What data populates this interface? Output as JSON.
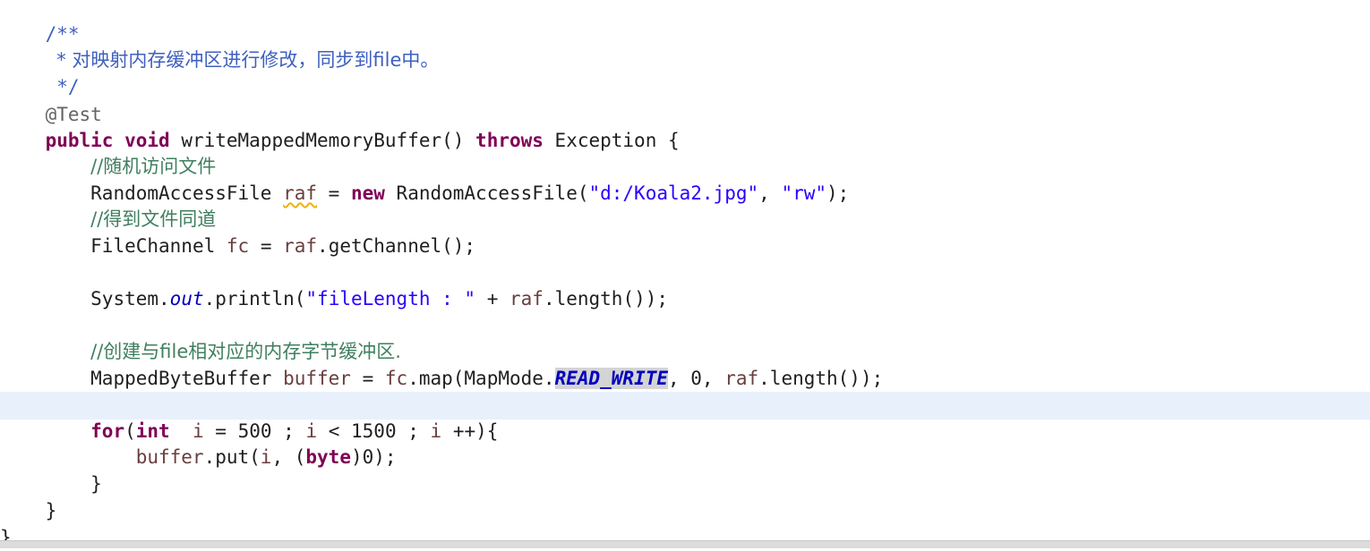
{
  "editor": {
    "lines": [
      {
        "indent": "    ",
        "tokens": [
          {
            "text": "/**",
            "kind": "javadoc"
          }
        ]
      },
      {
        "indent": "     ",
        "tokens": [
          {
            "text": "* 对映射内存缓冲区进行修改，同步到file中。",
            "kind": "javadoc"
          }
        ]
      },
      {
        "indent": "     ",
        "tokens": [
          {
            "text": "*/",
            "kind": "javadoc"
          }
        ]
      },
      {
        "indent": "    ",
        "tokens": [
          {
            "text": "@Test",
            "kind": "annotation"
          }
        ]
      },
      {
        "indent": "    ",
        "tokens": [
          {
            "text": "public",
            "kind": "keyword"
          },
          {
            "text": " "
          },
          {
            "text": "void",
            "kind": "keyword"
          },
          {
            "text": " writeMappedMemoryBuffer() "
          },
          {
            "text": "throws",
            "kind": "keyword"
          },
          {
            "text": " Exception {"
          }
        ]
      },
      {
        "indent": "        ",
        "tokens": [
          {
            "text": "//随机访问文件",
            "kind": "comment"
          }
        ]
      },
      {
        "indent": "        ",
        "tokens": [
          {
            "text": "RandomAccessFile "
          },
          {
            "text": "raf",
            "kind": "local-var warn"
          },
          {
            "text": " = "
          },
          {
            "text": "new",
            "kind": "keyword"
          },
          {
            "text": " RandomAccessFile("
          },
          {
            "text": "\"d:/Koala2.jpg\"",
            "kind": "string"
          },
          {
            "text": ", "
          },
          {
            "text": "\"rw\"",
            "kind": "string"
          },
          {
            "text": ");"
          }
        ]
      },
      {
        "indent": "        ",
        "tokens": [
          {
            "text": "//得到文件同道",
            "kind": "comment"
          }
        ]
      },
      {
        "indent": "        ",
        "tokens": [
          {
            "text": "FileChannel "
          },
          {
            "text": "fc",
            "kind": "local-var"
          },
          {
            "text": " = "
          },
          {
            "text": "raf",
            "kind": "local-var"
          },
          {
            "text": ".getChannel();"
          }
        ]
      },
      {
        "indent": "",
        "tokens": []
      },
      {
        "indent": "        ",
        "tokens": [
          {
            "text": "System."
          },
          {
            "text": "out",
            "kind": "static-field"
          },
          {
            "text": ".println("
          },
          {
            "text": "\"fileLength : \"",
            "kind": "string"
          },
          {
            "text": " + "
          },
          {
            "text": "raf",
            "kind": "local-var"
          },
          {
            "text": ".length());"
          }
        ]
      },
      {
        "indent": "",
        "tokens": []
      },
      {
        "indent": "        ",
        "tokens": [
          {
            "text": "//创建与file相对应的内存字节缓冲区.",
            "kind": "comment"
          }
        ]
      },
      {
        "indent": "        ",
        "tokens": [
          {
            "text": "MappedByteBuffer "
          },
          {
            "text": "buffer",
            "kind": "local-var"
          },
          {
            "text": " = "
          },
          {
            "text": "fc",
            "kind": "local-var"
          },
          {
            "text": ".map(MapMode."
          },
          {
            "text": "READ_WRITE",
            "kind": "const-field occurrence"
          },
          {
            "text": ", 0, "
          },
          {
            "text": "raf",
            "kind": "local-var"
          },
          {
            "text": ".length());"
          }
        ]
      },
      {
        "indent": "",
        "tokens": []
      },
      {
        "indent": "        ",
        "tokens": [
          {
            "text": "for",
            "kind": "keyword"
          },
          {
            "text": "("
          },
          {
            "text": "int",
            "kind": "keyword"
          },
          {
            "text": "  "
          },
          {
            "text": "i",
            "kind": "local-var"
          },
          {
            "text": " = 500 ; "
          },
          {
            "text": "i",
            "kind": "local-var"
          },
          {
            "text": " < 1500 ; "
          },
          {
            "text": "i",
            "kind": "local-var"
          },
          {
            "text": " ++){"
          }
        ]
      },
      {
        "indent": "            ",
        "tokens": [
          {
            "text": "buffer",
            "kind": "local-var"
          },
          {
            "text": ".put("
          },
          {
            "text": "i",
            "kind": "local-var"
          },
          {
            "text": ", ("
          },
          {
            "text": "byte",
            "kind": "keyword"
          },
          {
            "text": ")0);"
          }
        ]
      },
      {
        "indent": "        ",
        "tokens": [
          {
            "text": "}"
          }
        ]
      },
      {
        "indent": "    ",
        "tokens": [
          {
            "text": "}"
          }
        ]
      },
      {
        "indent": "",
        "tokens": [
          {
            "text": "}"
          }
        ]
      }
    ]
  },
  "colors": {
    "background": "#ffffff",
    "current_line": "#e8f0fb",
    "keyword": "#7f0055",
    "string": "#2a00ff",
    "javadoc": "#3f5fbf",
    "comment": "#3f7f5f",
    "field": "#0000c0",
    "local_variable": "#6a3e3e"
  }
}
